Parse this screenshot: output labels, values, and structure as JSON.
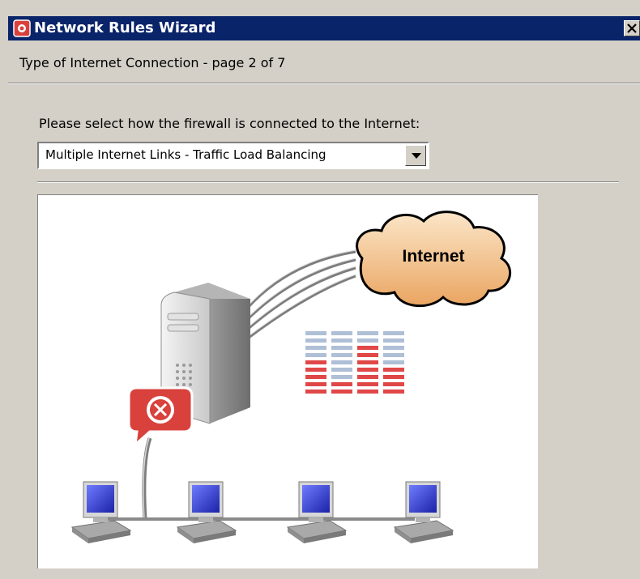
{
  "window": {
    "title": "Network Rules Wizard",
    "close_icon": "close-icon"
  },
  "page": {
    "header": "Type of Internet Connection - page 2 of 7",
    "prompt": "Please select how the firewall is connected to the Internet:"
  },
  "connection_select": {
    "selected": "Multiple Internet Links - Traffic Load Balancing"
  },
  "diagram": {
    "cloud_label": "Internet",
    "icons": [
      "internet-cloud-icon",
      "firewall-server-icon",
      "firewall-badge-icon",
      "load-balancing-bars-icon",
      "workstation-icon"
    ],
    "workstation_count": 4,
    "uplink_count": 4,
    "colors": {
      "cloud": "#f2c08c",
      "badge": "#d9413c",
      "bars_red": "#e04848",
      "bars_blue": "#aebfd6",
      "screen": "#2c35c8"
    }
  }
}
